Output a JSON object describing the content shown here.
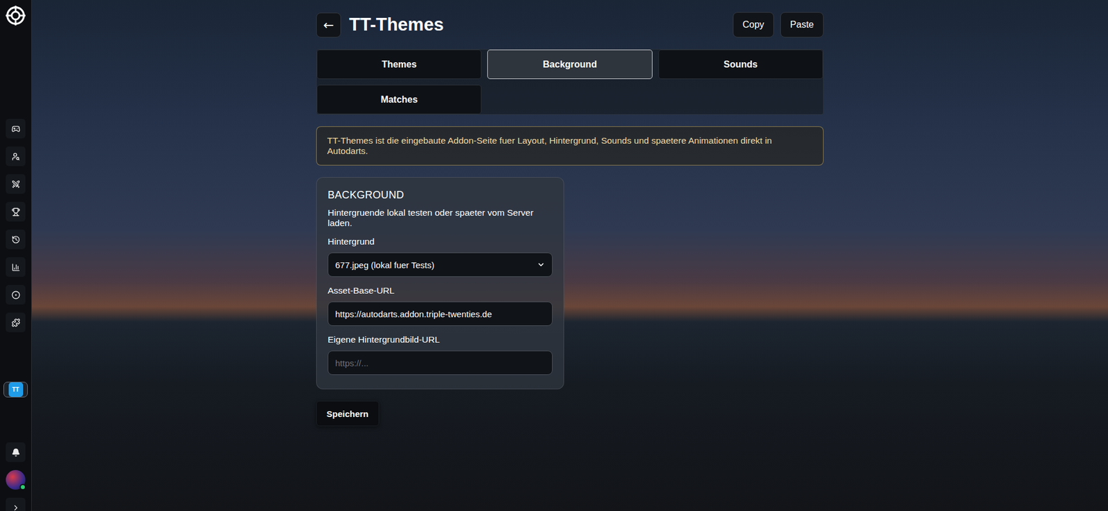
{
  "window": {
    "title": "TT-Themes"
  },
  "header": {
    "back": "←",
    "buttons": [
      "Copy",
      "Paste"
    ]
  },
  "tabs": [
    {
      "label": "Themes",
      "selected": false
    },
    {
      "label": "Background",
      "selected": true
    },
    {
      "label": "Sounds",
      "selected": false
    },
    {
      "label": "Matches",
      "selected": false
    }
  ],
  "banner": "TT-Themes ist die eingebaute Addon-Seite fuer Layout, Hintergrund, Sounds und spaetere Animationen direkt in Autodarts.",
  "sidebar": {
    "items": [
      {
        "selected": false
      },
      {
        "selected": false
      },
      {
        "selected": false
      },
      {
        "selected": false
      },
      {
        "selected": false
      },
      {
        "selected": false
      },
      {
        "selected": false
      },
      {
        "selected": false
      }
    ],
    "addon": {
      "label": "TT",
      "selected": true
    },
    "user": {
      "online": true
    }
  },
  "card": {
    "title": "BACKGROUND",
    "description": "Hintergruende lokal testen oder spaeter vom Server laden.",
    "fields": [
      {
        "kind": "select",
        "label": "Hintergrund",
        "value": "677.jpeg (lokal fuer Tests)",
        "placeholder": ""
      },
      {
        "kind": "text",
        "label": "Asset-Base-URL",
        "value": "https://autodarts.addon.triple-twenties.de",
        "placeholder": ""
      },
      {
        "kind": "text",
        "label": "Eigene Hintergrundbild-URL",
        "value": "",
        "placeholder": "https://..."
      }
    ]
  },
  "save_button": "Speichern"
}
